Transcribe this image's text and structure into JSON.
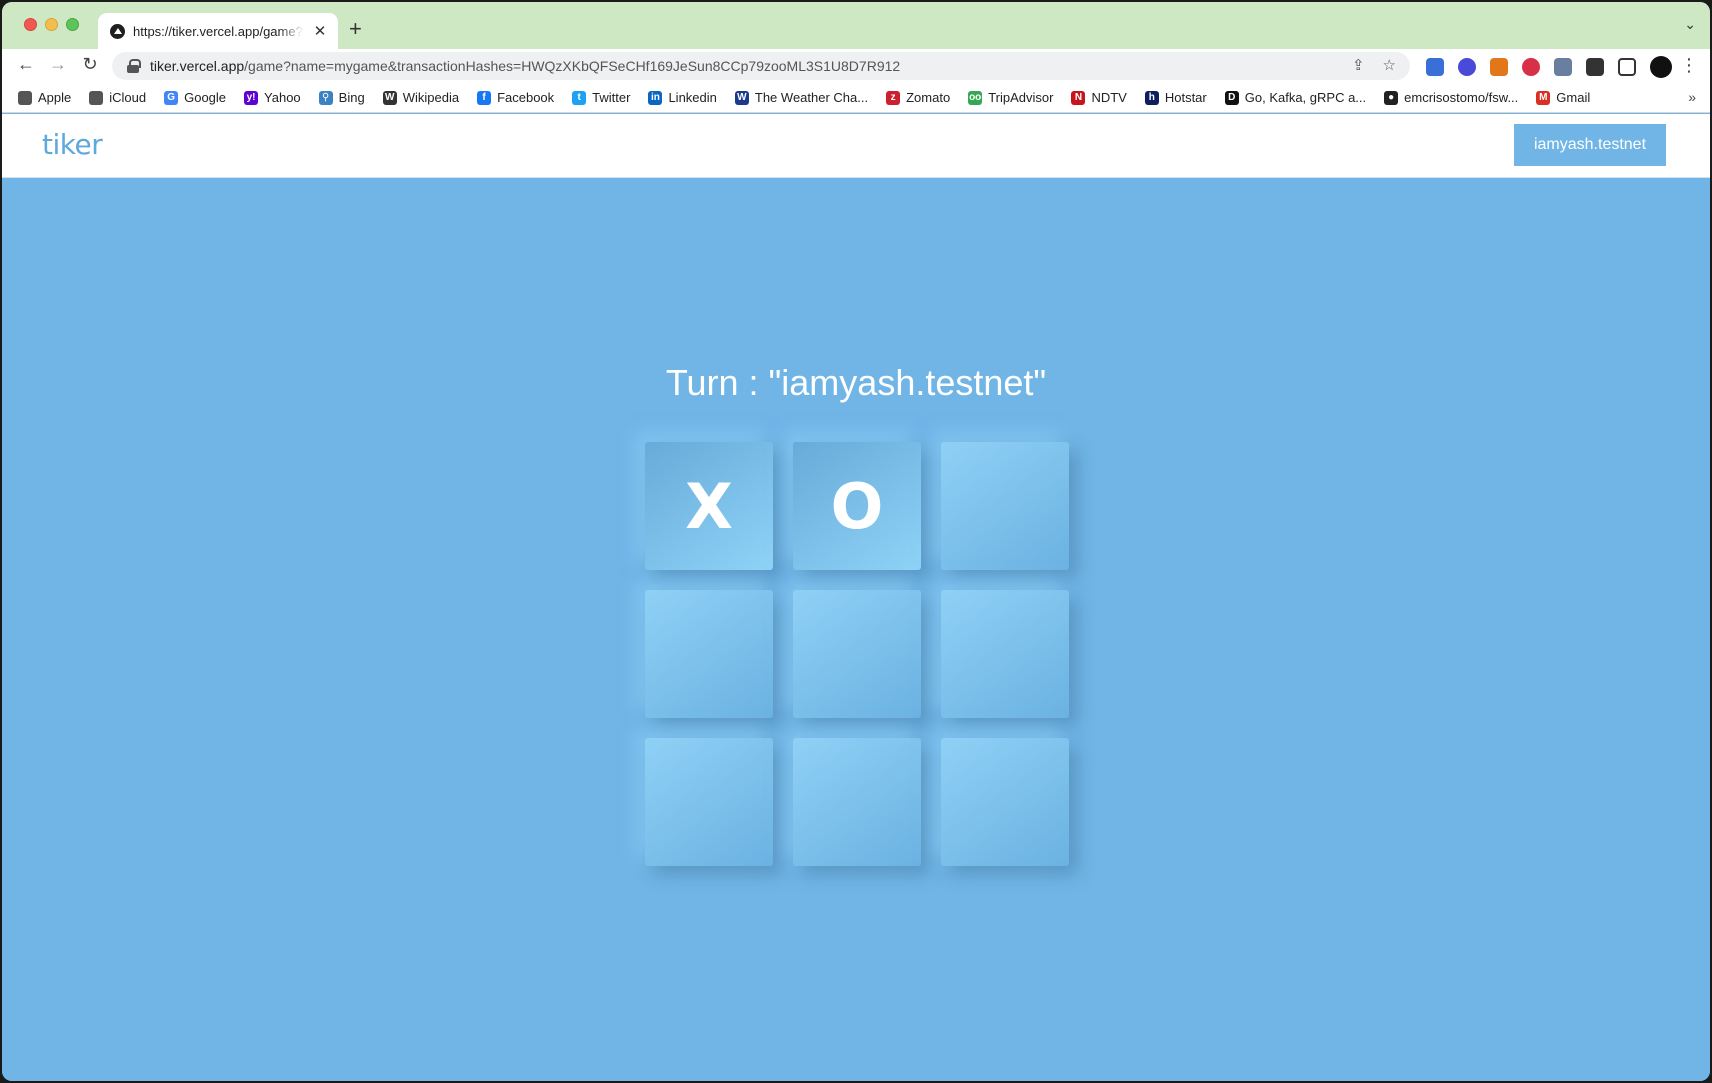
{
  "browser": {
    "tab_title": "https://tiker.vercel.app/game?n",
    "tab_close": "✕",
    "new_tab": "+",
    "tab_list": "⌄",
    "url_host": "tiker.vercel.app",
    "url_rest": "/game?name=mygame&transactionHashes=HWQzXKbQFSeCHf169JeSun8CCp79zooML3S1U8D7R912",
    "nav": {
      "back": "←",
      "forward": "→",
      "reload": "↻"
    },
    "omni_icons": {
      "share": "⇪",
      "star": "☆"
    },
    "menu": "⋮"
  },
  "bookmarks": [
    {
      "label": "Apple",
      "icon": "",
      "color": "#555555"
    },
    {
      "label": "iCloud",
      "icon": "",
      "color": "#555555"
    },
    {
      "label": "Google",
      "icon": "G",
      "color": "#4285f4"
    },
    {
      "label": "Yahoo",
      "icon": "y!",
      "color": "#5f01d1"
    },
    {
      "label": "Bing",
      "icon": "⚲",
      "color": "#3b82c4"
    },
    {
      "label": "Wikipedia",
      "icon": "W",
      "color": "#333333"
    },
    {
      "label": "Facebook",
      "icon": "f",
      "color": "#1877f2"
    },
    {
      "label": "Twitter",
      "icon": "t",
      "color": "#1da1f2"
    },
    {
      "label": "Linkedin",
      "icon": "in",
      "color": "#0a66c2"
    },
    {
      "label": "The Weather Cha...",
      "icon": "W",
      "color": "#1b3a8c"
    },
    {
      "label": "Zomato",
      "icon": "z",
      "color": "#cb202d"
    },
    {
      "label": "TripAdvisor",
      "icon": "oo",
      "color": "#34a853"
    },
    {
      "label": "NDTV",
      "icon": "N",
      "color": "#c4161c"
    },
    {
      "label": "Hotstar",
      "icon": "h",
      "color": "#0f1e5c"
    },
    {
      "label": "Go, Kafka, gRPC a...",
      "icon": "D",
      "color": "#111111"
    },
    {
      "label": "emcrisostomo/fsw...",
      "icon": "●",
      "color": "#222222"
    },
    {
      "label": "Gmail",
      "icon": "M",
      "color": "#d93025"
    }
  ],
  "bookmarks_more": "»",
  "app": {
    "brand": "tiker",
    "account": "iamyash.testnet",
    "turn_text": "Turn : \"iamyash.testnet\""
  },
  "board": [
    "X",
    "O",
    "",
    "",
    "",
    "",
    "",
    "",
    ""
  ],
  "colors": {
    "page_bg": "#70b5e6",
    "brand": "#5fa8dc",
    "tab_strip": "#cfe8c4"
  }
}
